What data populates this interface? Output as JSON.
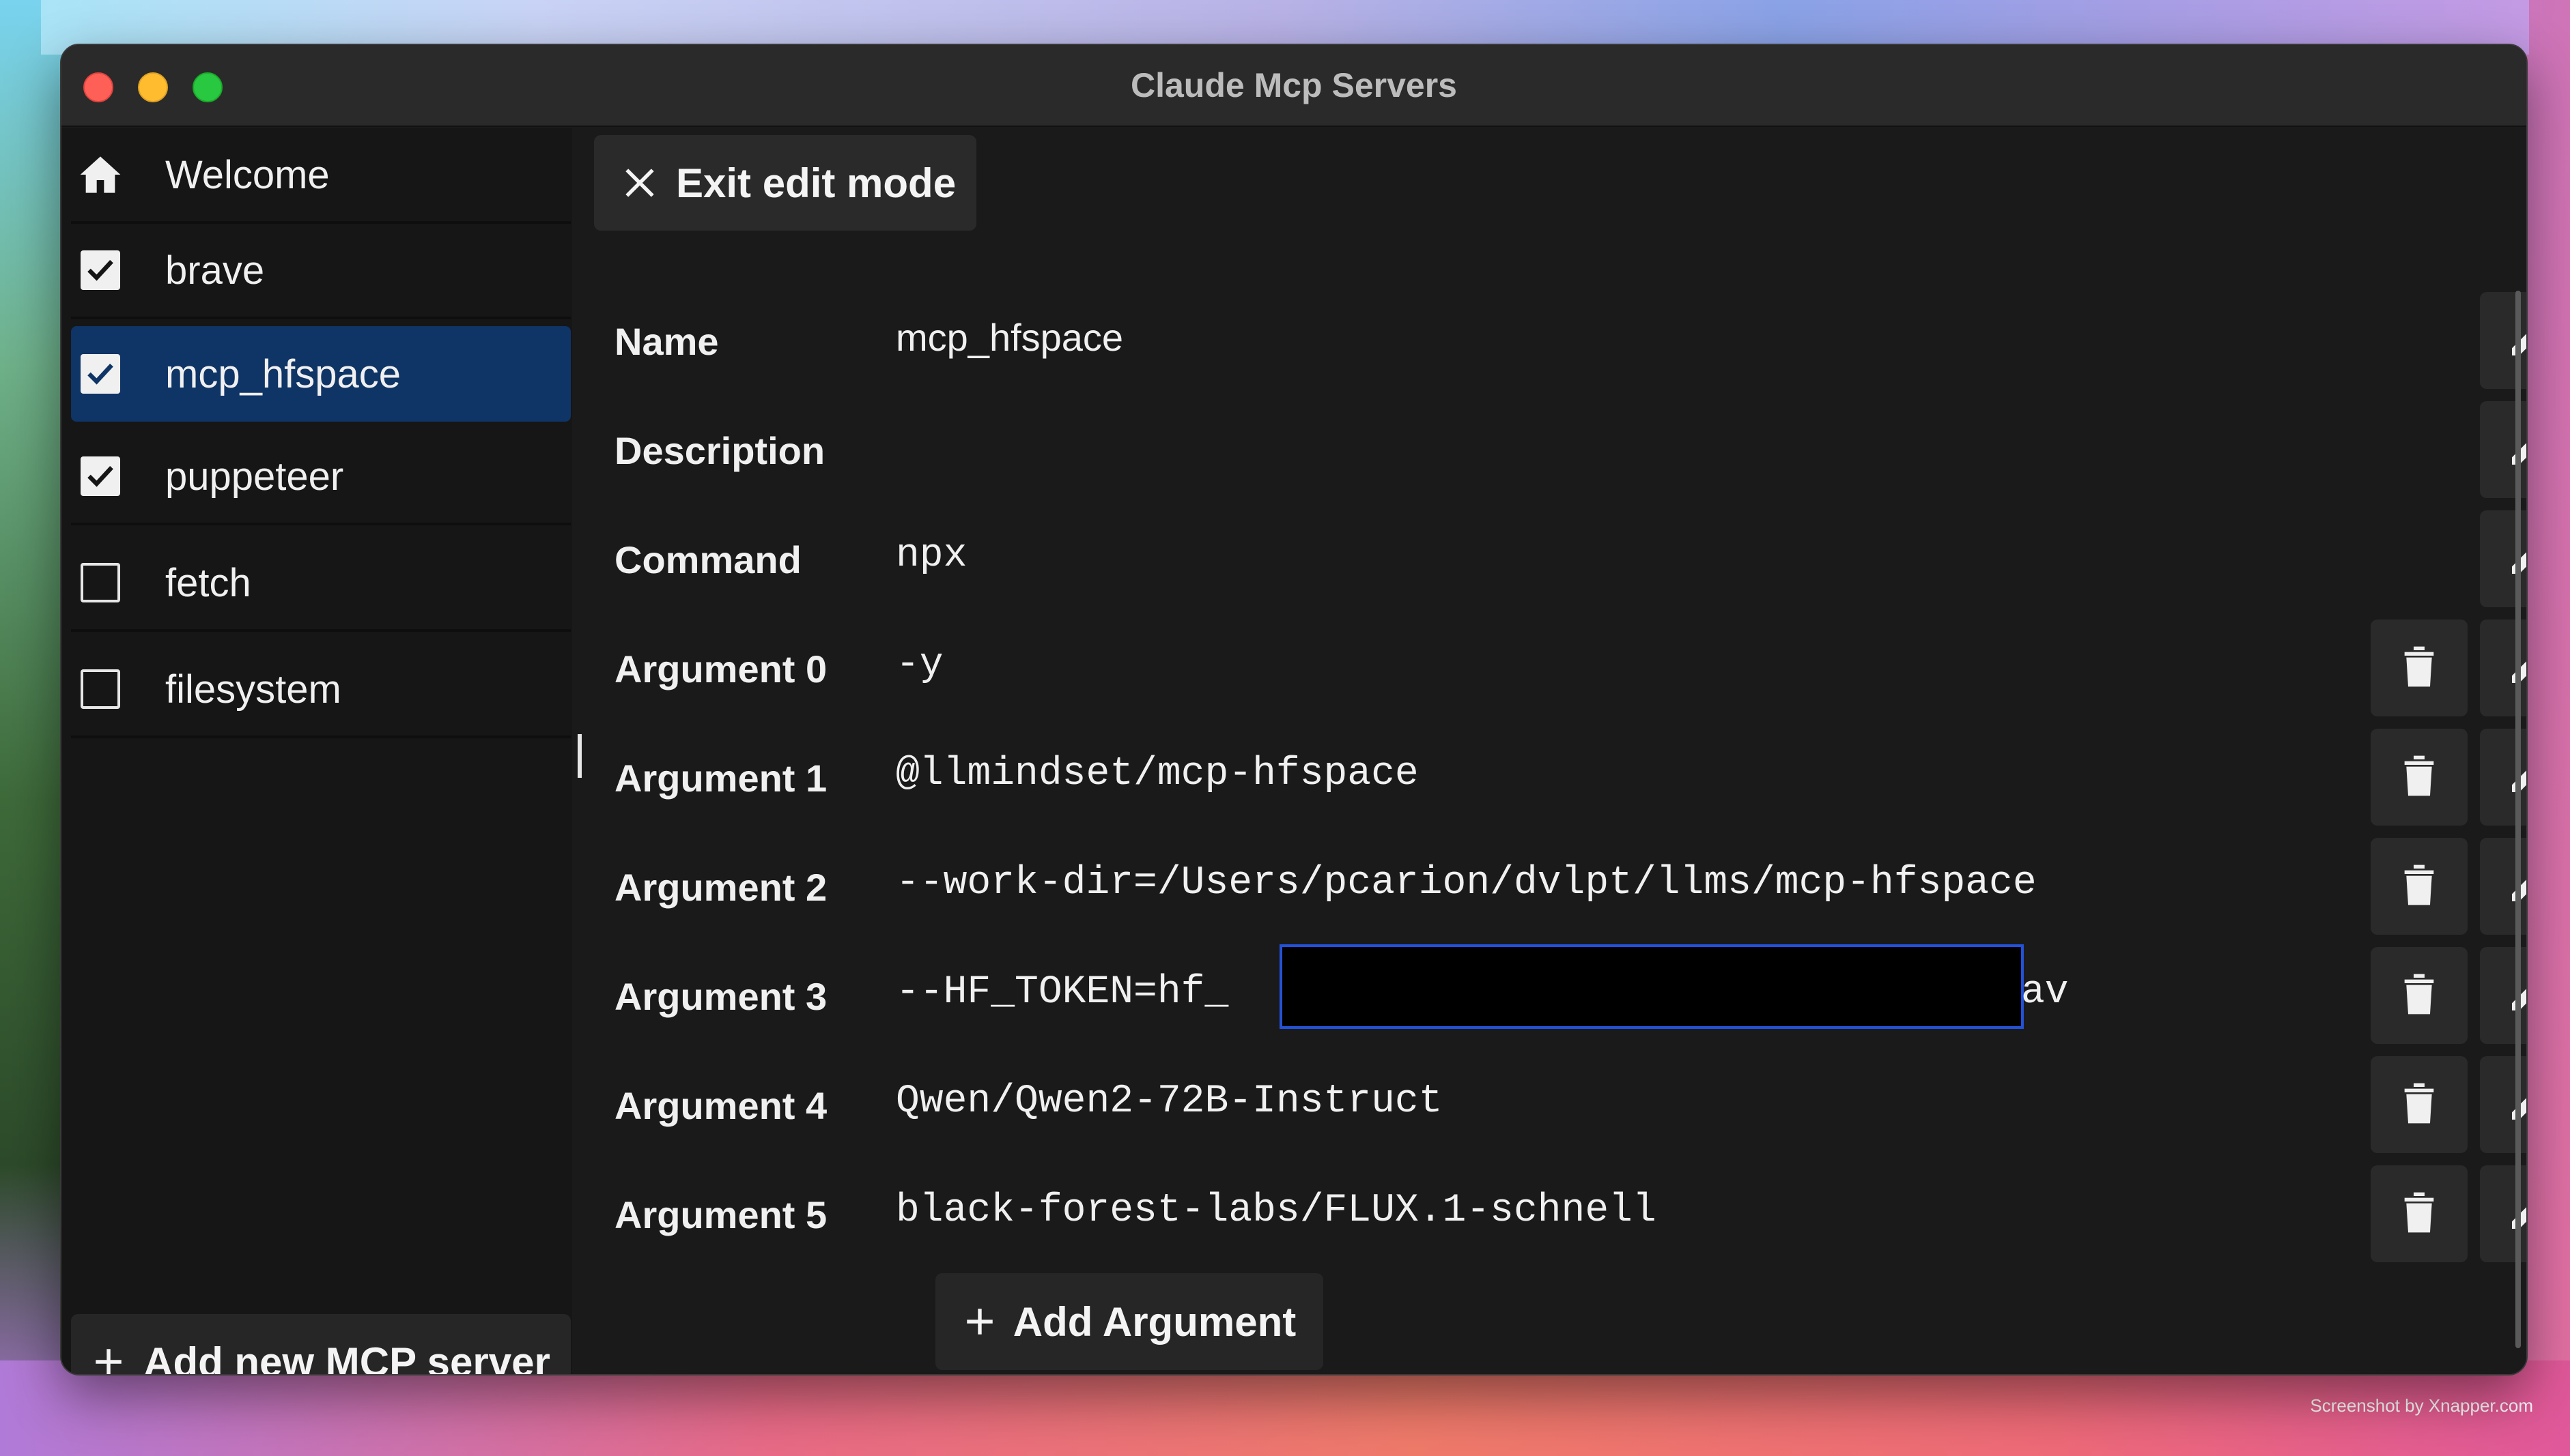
{
  "window": {
    "title": "Claude Mcp Servers"
  },
  "watermark": "Screenshot by Xnapper.com",
  "sidebar": {
    "welcome_label": "Welcome",
    "items": [
      {
        "label": "brave",
        "checked": true
      },
      {
        "label": "mcp_hfspace",
        "checked": true,
        "selected": true
      },
      {
        "label": "puppeteer",
        "checked": true
      },
      {
        "label": "fetch",
        "checked": false
      },
      {
        "label": "filesystem",
        "checked": false
      }
    ],
    "add_server_label": "Add new MCP server"
  },
  "main": {
    "exit_edit_label": "Exit edit mode",
    "fields": {
      "name": {
        "label": "Name",
        "value": "mcp_hfspace"
      },
      "description": {
        "label": "Description",
        "value": ""
      },
      "command": {
        "label": "Command",
        "value": "npx"
      }
    },
    "arguments": [
      {
        "label": "Argument 0",
        "value": "-y"
      },
      {
        "label": "Argument 1",
        "value": "@llmindset/mcp-hfspace"
      },
      {
        "label": "Argument 2",
        "value": "--work-dir=/Users/pcarion/dvlpt/llms/mcp-hfspace"
      },
      {
        "label": "Argument 3",
        "value_prefix": "--HF_TOKEN=hf_",
        "value_suffix": "av",
        "redacted": true
      },
      {
        "label": "Argument 4",
        "value": "Qwen/Qwen2-72B-Instruct"
      },
      {
        "label": "Argument 5",
        "value": "black-forest-labs/FLUX.1-schnell"
      }
    ],
    "add_argument_label": "Add Argument"
  },
  "colors": {
    "selected_bg": "#0f3466",
    "redaction_border": "#2352d8",
    "window_bg": "#1a1a1a"
  }
}
